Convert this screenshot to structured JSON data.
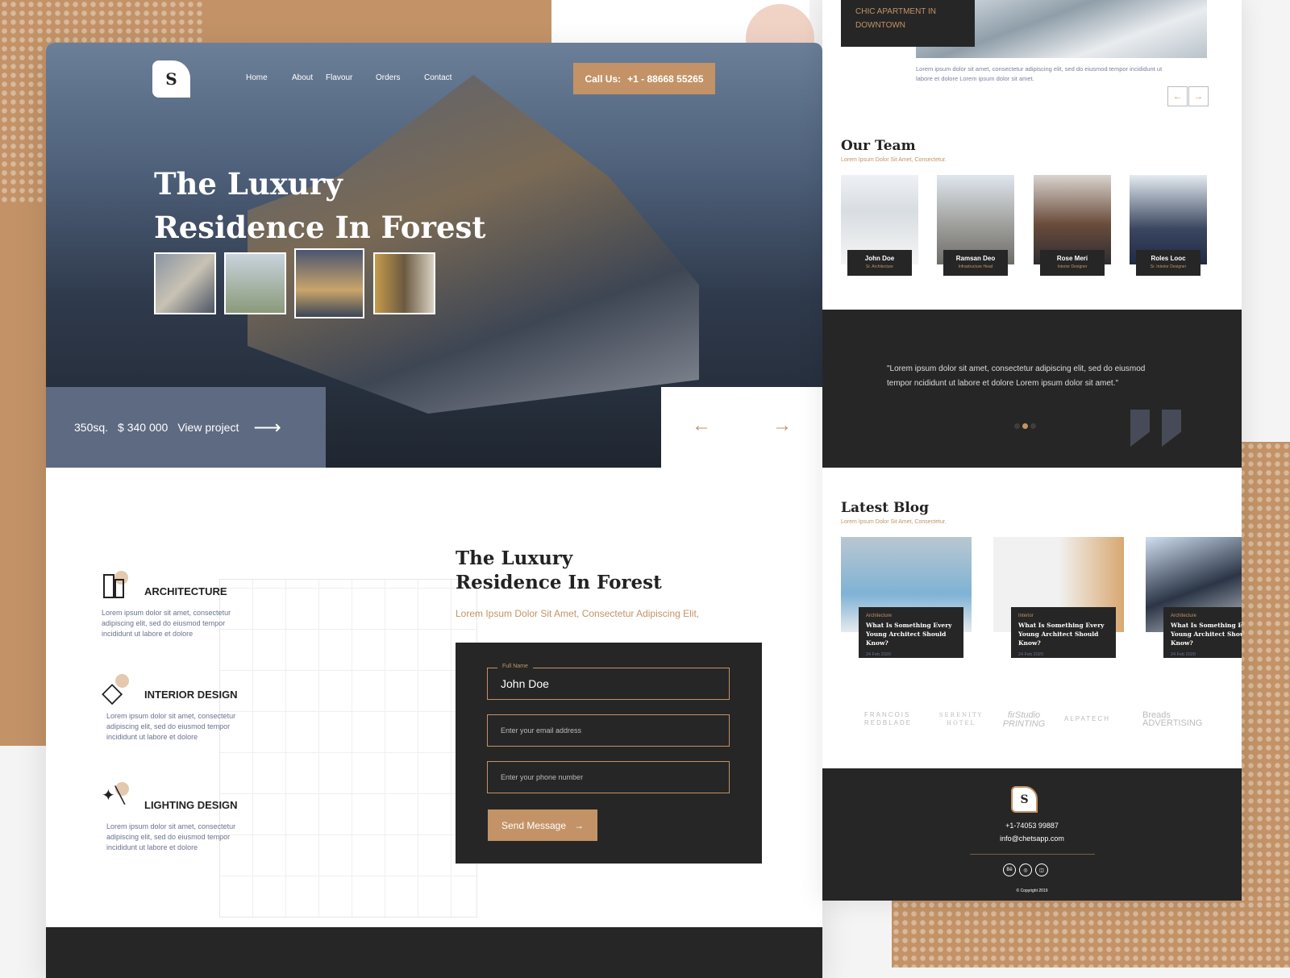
{
  "brand": {
    "logo_letter": "S"
  },
  "nav": {
    "items": [
      "Home",
      "About",
      "Flavour",
      "Orders",
      "Contact"
    ],
    "call_label": "Call Us:",
    "call_number": "+1 - 88668 55265"
  },
  "hero": {
    "title_line1": "The Luxury",
    "title_line2": "Residence In Forest",
    "area": "350sq.",
    "price": "$ 340 000",
    "view_label": "View project"
  },
  "services": [
    {
      "title": "ARCHITECTURE",
      "text": "Lorem ipsum dolor sit amet, consectetur adipiscing elit, sed do eiusmod tempor incididunt ut labore et dolore",
      "icon": "building-icon"
    },
    {
      "title": "INTERIOR DESIGN",
      "text": "Lorem ipsum dolor sit amet, consectetur adipiscing elit, sed do eiusmod tempor incididunt ut labore et dolore",
      "icon": "diamond-icon"
    },
    {
      "title": "LIGHTING DESIGN",
      "text": "Lorem ipsum dolor sit amet, consectetur adipiscing elit, sed do eiusmod tempor incididunt ut labore et dolore",
      "icon": "magic-wand-icon"
    }
  ],
  "contact": {
    "title_line1": "The Luxury",
    "title_line2": "Residence In Forest",
    "subtitle": "Lorem Ipsum Dolor Sit Amet, Consectetur Adipiscing Elit,",
    "name_label": "Full Name",
    "name_value": "John Doe",
    "email_placeholder": "Enter your email address",
    "phone_placeholder": "Enter your phone number",
    "send_label": "Send Message"
  },
  "project": {
    "title": "CHIC APARTMENT IN DOWNTOWN",
    "text": "Lorem ipsum dolor sit amet, consectetur adipiscing elit, sed do eiusmod tempor incididunt ut labore et dolore Lorem ipsum dolor sit amet."
  },
  "team": {
    "title": "Our Team",
    "subtitle": "Lorem Ipsum Dolor Sit Amet, Consectetur.",
    "members": [
      {
        "name": "John Doe",
        "role": "Sr. Architecture"
      },
      {
        "name": "Ramsan Deo",
        "role": "Infrastructure Head"
      },
      {
        "name": "Rose Meri",
        "role": "Interior Designer"
      },
      {
        "name": "Roles Looc",
        "role": "Sr. Interior Designer"
      }
    ]
  },
  "testimonial": {
    "quote": "\"Lorem ipsum dolor sit amet, consectetur adipiscing elit, sed do eiusmod tempor ncididunt ut labore et dolore Lorem ipsum dolor sit amet.\"",
    "active_dot": 2,
    "dot_count": 3
  },
  "blog": {
    "title": "Latest Blog",
    "subtitle": "Lorem Ipsum Dolor Sit Amet, Consectetur.",
    "posts": [
      {
        "category": "Architecture",
        "title": "What Is Something Every Young Architect Should Know?",
        "date": "24 Feb 2020"
      },
      {
        "category": "Interior",
        "title": "What Is Something Every Young Architect Should Know?",
        "date": "24 Feb 2020"
      },
      {
        "category": "Architecture",
        "title": "What Is Something Every Young Architect Should Know?",
        "date": "24 Feb 2020"
      }
    ]
  },
  "partners": [
    "FRANCOIS REDBLADE",
    "SERENITY HOTEL",
    "firStudio PRINTING",
    "ALPATECH",
    "Breads ADVERTISING"
  ],
  "footer": {
    "phone": "+1-74053 99887",
    "email": "info@chetsapp.com",
    "social": [
      "Bē",
      "◎",
      "◫"
    ],
    "copyright": "© Copyright 2019"
  },
  "colors": {
    "accent": "#c39367",
    "dark": "#262626",
    "slate": "#5e6a82"
  }
}
